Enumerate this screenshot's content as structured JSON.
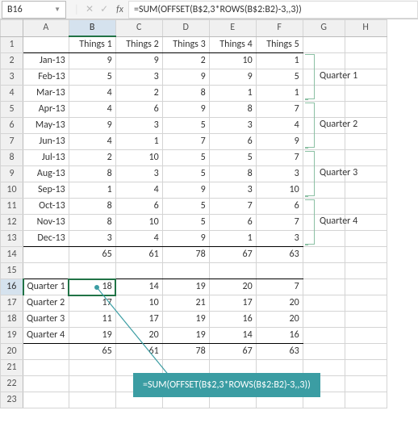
{
  "nameBox": "B16",
  "fxLabel": "fx",
  "formula": "=SUM(OFFSET(B$2,3*ROWS(B$2:B2)-3,,3))",
  "cols": [
    "A",
    "B",
    "C",
    "D",
    "E",
    "F",
    "G",
    "H"
  ],
  "headers": {
    "b": "Things 1",
    "c": "Things 2",
    "d": "Things 3",
    "e": "Things 4",
    "f": "Things 5"
  },
  "months": [
    {
      "m": "Jan-13",
      "v": [
        9,
        9,
        2,
        10,
        1
      ]
    },
    {
      "m": "Feb-13",
      "v": [
        5,
        3,
        9,
        9,
        5
      ]
    },
    {
      "m": "Mar-13",
      "v": [
        4,
        2,
        8,
        1,
        1
      ]
    },
    {
      "m": "Apr-13",
      "v": [
        4,
        6,
        9,
        8,
        7
      ]
    },
    {
      "m": "May-13",
      "v": [
        9,
        3,
        5,
        3,
        4
      ]
    },
    {
      "m": "Jun-13",
      "v": [
        4,
        1,
        7,
        6,
        9
      ]
    },
    {
      "m": "Jul-13",
      "v": [
        2,
        10,
        5,
        5,
        7
      ]
    },
    {
      "m": "Aug-13",
      "v": [
        8,
        3,
        5,
        8,
        3
      ]
    },
    {
      "m": "Sep-13",
      "v": [
        1,
        4,
        9,
        3,
        10
      ]
    },
    {
      "m": "Oct-13",
      "v": [
        8,
        6,
        5,
        7,
        6
      ]
    },
    {
      "m": "Nov-13",
      "v": [
        8,
        10,
        5,
        6,
        7
      ]
    },
    {
      "m": "Dec-13",
      "v": [
        3,
        4,
        9,
        1,
        3
      ]
    }
  ],
  "monthTotals": [
    65,
    61,
    78,
    67,
    63
  ],
  "quarters": [
    {
      "q": "Quarter 1",
      "v": [
        18,
        14,
        19,
        20,
        7
      ]
    },
    {
      "q": "Quarter 2",
      "v": [
        17,
        10,
        21,
        17,
        20
      ]
    },
    {
      "q": "Quarter 3",
      "v": [
        11,
        17,
        19,
        16,
        20
      ]
    },
    {
      "q": "Quarter 4",
      "v": [
        19,
        20,
        19,
        14,
        16
      ]
    }
  ],
  "quarterTotals": [
    65,
    61,
    78,
    67,
    63
  ],
  "bracketLabels": {
    "q1": "Quarter 1",
    "q2": "Quarter 2",
    "q3": "Quarter 3",
    "q4": "Quarter 4"
  },
  "callout": "=SUM(OFFSET(B$2,3*ROWS(B$2:B2)-3,,3))",
  "selectedCell": "B16",
  "chart_data": {
    "type": "table",
    "title": "",
    "series_headers": [
      "Things 1",
      "Things 2",
      "Things 3",
      "Things 4",
      "Things 5"
    ],
    "rows_months": [
      "Jan-13",
      "Feb-13",
      "Mar-13",
      "Apr-13",
      "May-13",
      "Jun-13",
      "Jul-13",
      "Aug-13",
      "Sep-13",
      "Oct-13",
      "Nov-13",
      "Dec-13"
    ],
    "data_months": [
      [
        9,
        9,
        2,
        10,
        1
      ],
      [
        5,
        3,
        9,
        9,
        5
      ],
      [
        4,
        2,
        8,
        1,
        1
      ],
      [
        4,
        6,
        9,
        8,
        7
      ],
      [
        9,
        3,
        5,
        3,
        4
      ],
      [
        4,
        1,
        7,
        6,
        9
      ],
      [
        2,
        10,
        5,
        5,
        7
      ],
      [
        8,
        3,
        5,
        8,
        3
      ],
      [
        1,
        4,
        9,
        3,
        10
      ],
      [
        8,
        6,
        5,
        7,
        6
      ],
      [
        8,
        10,
        5,
        6,
        7
      ],
      [
        3,
        4,
        9,
        1,
        3
      ]
    ],
    "month_totals": [
      65,
      61,
      78,
      67,
      63
    ],
    "rows_quarters": [
      "Quarter 1",
      "Quarter 2",
      "Quarter 3",
      "Quarter 4"
    ],
    "data_quarters": [
      [
        18,
        14,
        19,
        20,
        7
      ],
      [
        17,
        10,
        21,
        17,
        20
      ],
      [
        11,
        17,
        19,
        16,
        20
      ],
      [
        19,
        20,
        19,
        14,
        16
      ]
    ],
    "quarter_totals": [
      65,
      61,
      78,
      67,
      63
    ]
  }
}
